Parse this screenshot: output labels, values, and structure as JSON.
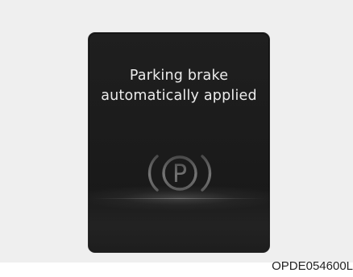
{
  "display": {
    "message_line1": "Parking brake",
    "message_line2": "automatically applied",
    "icon": "parking-brake-icon",
    "icon_letter": "P",
    "icon_color": "#7a7a7a",
    "text_color": "#ececec",
    "screen_color": "#1c1c1c"
  },
  "figure_code": "OPDE054600L"
}
